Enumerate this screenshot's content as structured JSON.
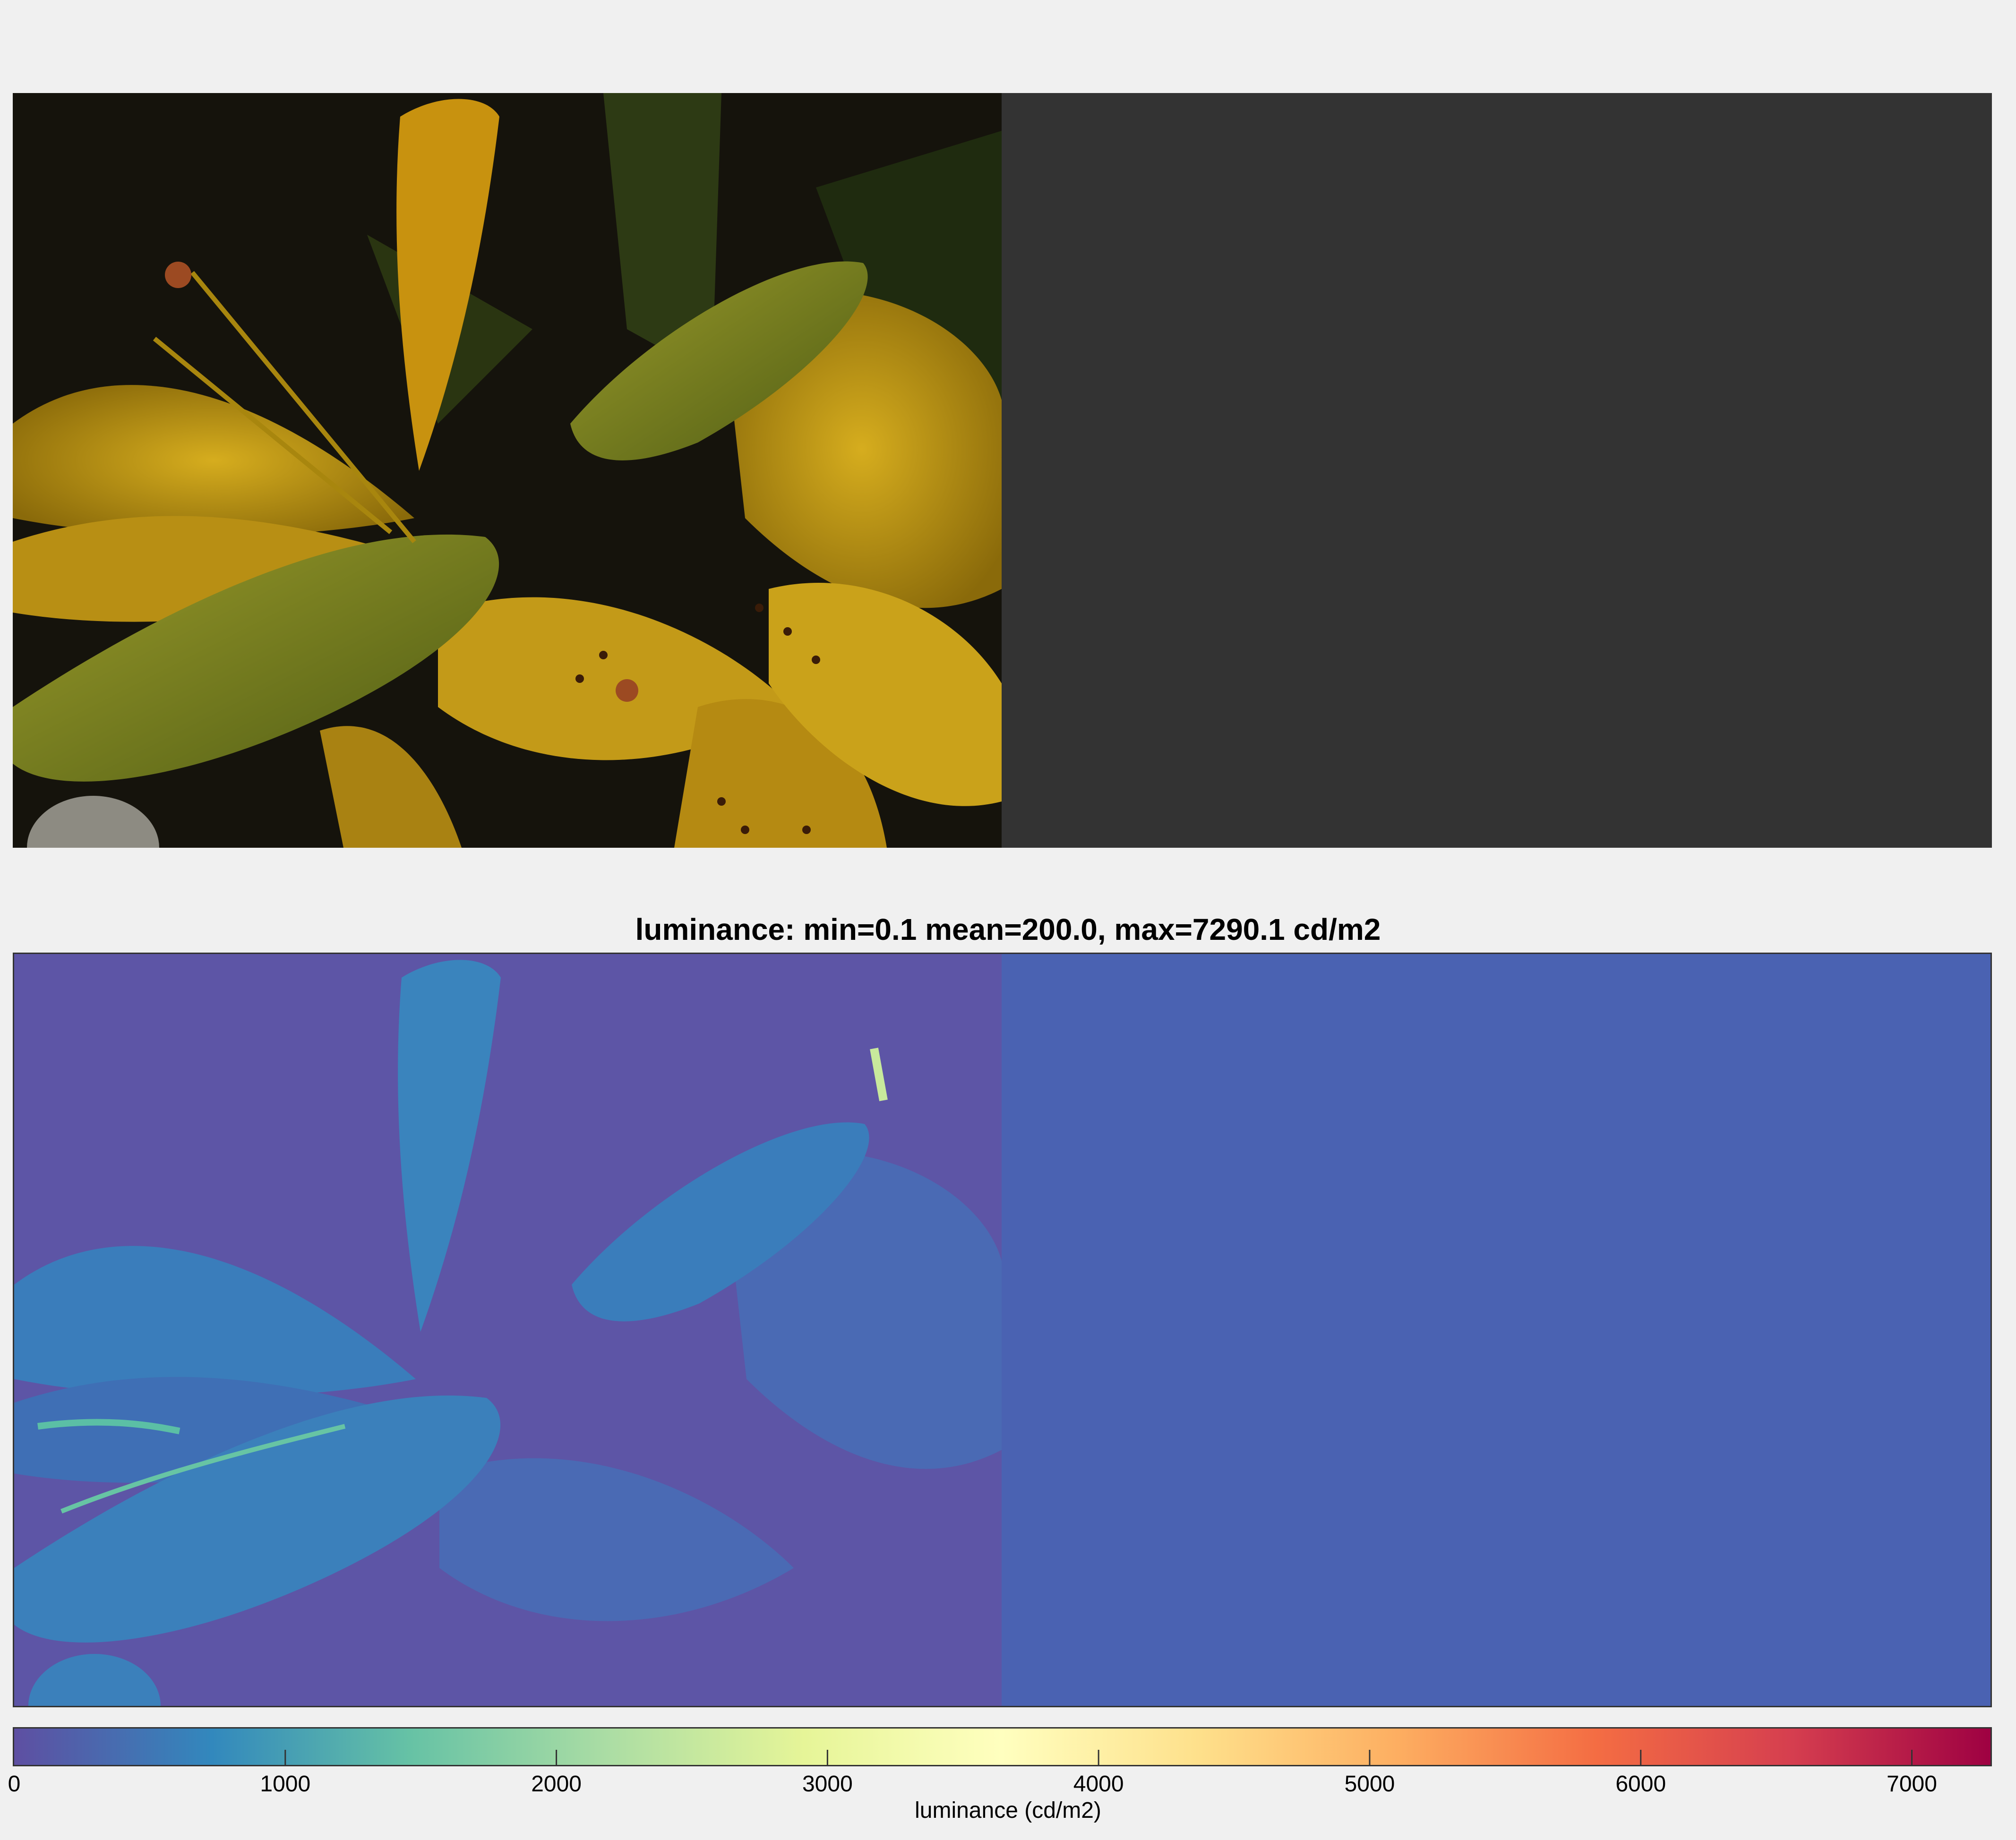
{
  "colors": {
    "background": "#f0f0f0",
    "photo_panel_right": "#333333",
    "luminance_panel_right": "#4a62b2",
    "colormap": "Spectral (reversed)",
    "colormap_stops": [
      "#5e4fa2",
      "#3288bd",
      "#66c2a5",
      "#abdda4",
      "#e6f598",
      "#ffffbf",
      "#fee08b",
      "#fdae61",
      "#f46d43",
      "#d53e4f",
      "#9e0142"
    ]
  },
  "photo": {
    "subject": "yellow lily flowers"
  },
  "chart_data": {
    "type": "heatmap",
    "title": "luminance: min=0.1 mean=200.0, max=7290.1 cd/m2",
    "stats": {
      "min": 0.1,
      "mean": 200.0,
      "max": 7290.1,
      "unit": "cd/m2"
    },
    "colorbar": {
      "label": "luminance (cd/m2)",
      "range": [
        0,
        7290.1
      ],
      "ticks": [
        0,
        1000,
        2000,
        3000,
        4000,
        5000,
        6000,
        7000
      ],
      "tick_labels": [
        "0",
        "1000",
        "2000",
        "3000",
        "4000",
        "5000",
        "6000",
        "7000"
      ]
    }
  }
}
